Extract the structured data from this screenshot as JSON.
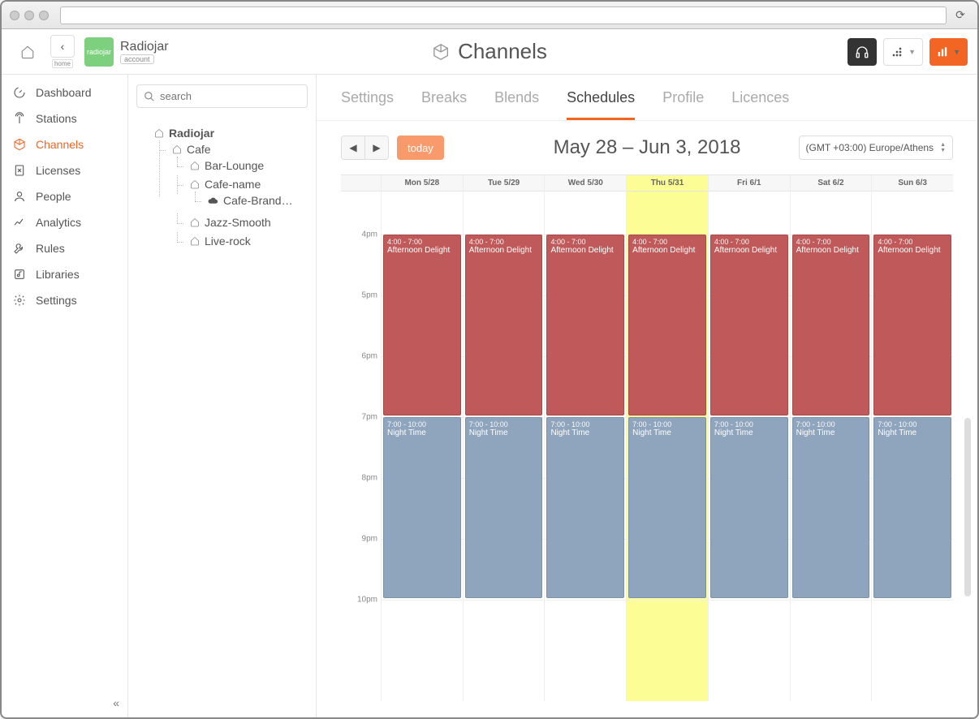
{
  "browser": {
    "reload_label": "⟳"
  },
  "header": {
    "home_label": "home",
    "brand_logo_text": "radiojar",
    "brand_name": "Radiojar",
    "brand_sub": "account",
    "page_title": "Channels"
  },
  "sidebar": {
    "items": [
      {
        "icon": "gauge",
        "label": "Dashboard"
      },
      {
        "icon": "antenna",
        "label": "Stations"
      },
      {
        "icon": "cube",
        "label": "Channels"
      },
      {
        "icon": "doc",
        "label": "Licenses"
      },
      {
        "icon": "person",
        "label": "People"
      },
      {
        "icon": "chart",
        "label": "Analytics"
      },
      {
        "icon": "wrench",
        "label": "Rules"
      },
      {
        "icon": "music",
        "label": "Libraries"
      },
      {
        "icon": "gear",
        "label": "Settings"
      }
    ],
    "active_index": 2
  },
  "treepanel": {
    "search_placeholder": "search",
    "root": {
      "label": "Radiojar",
      "children": [
        {
          "label": "Cafe",
          "children": [
            {
              "label": "Bar-Lounge"
            },
            {
              "label": "Cafe-name",
              "children": [
                {
                  "label": "Cafe-Brand…",
                  "icon": "cloud"
                }
              ]
            },
            {
              "label": "Jazz-Smooth"
            },
            {
              "label": "Live-rock"
            }
          ]
        }
      ]
    }
  },
  "tabs": {
    "items": [
      "Settings",
      "Breaks",
      "Blends",
      "Schedules",
      "Profile",
      "Licences"
    ],
    "active_index": 3
  },
  "toolbar": {
    "today_label": "today",
    "daterange": "May 28 – Jun 3, 2018",
    "timezone": "(GMT +03:00) Europe/Athens"
  },
  "calendar": {
    "hour_start": 15.3,
    "hour_end": 22.5,
    "pixels_per_hour": 75,
    "today_index": 3,
    "days": [
      {
        "label": "Mon 5/28"
      },
      {
        "label": "Tue 5/29"
      },
      {
        "label": "Wed 5/30"
      },
      {
        "label": "Thu 5/31"
      },
      {
        "label": "Fri 6/1"
      },
      {
        "label": "Sat 6/2"
      },
      {
        "label": "Sun 6/3"
      }
    ],
    "hours": [
      {
        "h": 16,
        "label": "4pm"
      },
      {
        "h": 17,
        "label": "5pm"
      },
      {
        "h": 18,
        "label": "6pm"
      },
      {
        "h": 19,
        "label": "7pm"
      },
      {
        "h": 20,
        "label": "8pm"
      },
      {
        "h": 21,
        "label": "9pm"
      },
      {
        "h": 22,
        "label": "10pm"
      }
    ],
    "event_templates": [
      {
        "time": "4:00 - 7:00",
        "name": "Afternoon Delight",
        "start": 16,
        "end": 19,
        "cls": "ev-red"
      },
      {
        "time": "7:00 - 10:00",
        "name": "Night Time",
        "start": 19,
        "end": 22,
        "cls": "ev-blue"
      }
    ]
  }
}
